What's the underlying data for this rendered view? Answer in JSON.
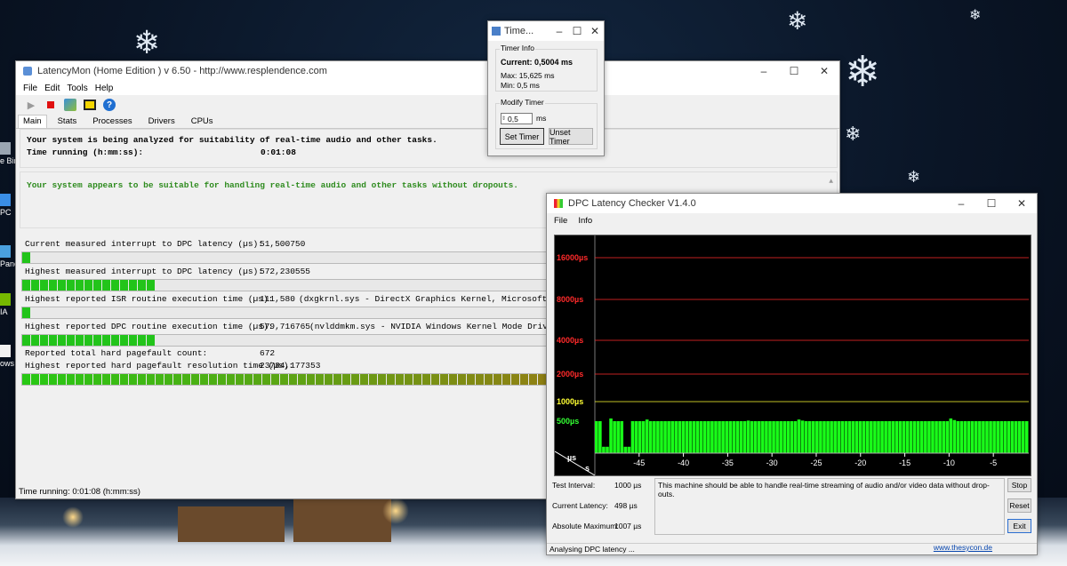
{
  "desktop": {
    "icons": [
      {
        "label": "e Bin",
        "name": "desktop-icon-recycle-bin"
      },
      {
        "label": "PC",
        "name": "desktop-icon-this-pc"
      },
      {
        "label": "Pane",
        "name": "desktop-icon-control-panel"
      },
      {
        "label": "IA",
        "name": "desktop-icon-nvidia"
      },
      {
        "label": "ows",
        "name": "desktop-icon-windows"
      }
    ]
  },
  "latencymon": {
    "title": "LatencyMon  (Home Edition )  v 6.50 - http://www.resplendence.com",
    "menu": [
      "File",
      "Edit",
      "Tools",
      "Help"
    ],
    "tabs": [
      "Main",
      "Stats",
      "Processes",
      "Drivers",
      "CPUs"
    ],
    "active_tab": "Main",
    "analysis_line": "Your system is being analyzed for suitability of real-time audio and other tasks.",
    "time_running_label": "Time running (h:mm:ss):",
    "time_running_value": "0:01:08",
    "verdict": "Your system appears to be suitable for handling real-time audio and other tasks without dropouts.",
    "verdict_color": "#2e8b1e",
    "metrics": {
      "current_interrupt_label": "Current measured interrupt to DPC latency (µs):",
      "current_interrupt_value": "51,500750",
      "current_interrupt_level": 0.011,
      "highest_interrupt_label": "Highest measured interrupt to DPC latency (µs):",
      "highest_interrupt_value": "572,230555",
      "highest_interrupt_level": 0.159,
      "isr_label": "Highest reported ISR routine execution time (µs):",
      "isr_value": "111,580",
      "isr_driver": "(dxgkrnl.sys - DirectX Graphics Kernel, Microsoft Corporation)",
      "isr_level": 0.013,
      "dpc_label": "Highest reported DPC routine execution time (µs):",
      "dpc_value": "579,716765",
      "dpc_driver": "(nvlddmkm.sys - NVIDIA Windows Kernel Mode Driver, Version",
      "dpc_level": 0.165,
      "pagefault_count_label": "Reported total hard pagefault count:",
      "pagefault_count_value": "672",
      "pagefault_res_label": "Highest reported hard pagefault resolution time (µs):",
      "pagefault_res_value": "23784,177353",
      "pagefault_res_level": 1.0
    },
    "status": "Time running: 0:01:08  (h:mm:ss)"
  },
  "timer": {
    "title": "Time...",
    "group_info": "Timer Info",
    "current_label": "Current:",
    "current_value": "0,5004 ms",
    "max_line": "Max: 15,625 ms",
    "min_line": "Min: 0,5 ms",
    "group_modify": "Modify Timer",
    "input_value": "0,5",
    "unit": "ms",
    "set_button": "Set Timer",
    "unset_button": "Unset Timer"
  },
  "dpc": {
    "title": "DPC Latency Checker V1.4.0",
    "menu": [
      "File",
      "Info"
    ],
    "y_labels": [
      {
        "text": "16000µs",
        "value": 16000,
        "color": "#ff2a2a"
      },
      {
        "text": "8000µs",
        "value": 8000,
        "color": "#ff2a2a"
      },
      {
        "text": "4000µs",
        "value": 4000,
        "color": "#ff2a2a"
      },
      {
        "text": "2000µs",
        "value": 2000,
        "color": "#ff2a2a"
      },
      {
        "text": "1000µs",
        "value": 1000,
        "color": "#ffff33"
      },
      {
        "text": "500µs",
        "value": 500,
        "color": "#33ff33"
      }
    ],
    "x_labels": [
      "-45",
      "-40",
      "-35",
      "-30",
      "-25",
      "-20",
      "-15",
      "-10",
      "-5"
    ],
    "axis_units": {
      "y": "µs",
      "x": "s"
    },
    "test_interval_label": "Test Interval:",
    "test_interval_value": "1000 µs",
    "current_latency_label": "Current Latency:",
    "current_latency_value": "498 µs",
    "absolute_max_label": "Absolute Maximum:",
    "absolute_max_value": "1007 µs",
    "message": "This machine should be able to handle real-time streaming of audio and/or video data without drop-outs.",
    "buttons": {
      "stop": "Stop",
      "reset": "Reset",
      "exit": "Exit"
    },
    "status": "Analysing DPC latency ...",
    "link": "www.thesycon.de"
  },
  "chart_data": {
    "type": "bar",
    "title": "",
    "xlabel": "s",
    "ylabel": "µs",
    "x_ticks": [
      -45,
      -40,
      -35,
      -30,
      -25,
      -20,
      -15,
      -10,
      -5
    ],
    "y_ticks": [
      500,
      1000,
      2000,
      4000,
      8000,
      16000
    ],
    "x_range": [
      -50,
      -1
    ],
    "values": [
      500,
      500,
      100,
      100,
      550,
      500,
      500,
      500,
      100,
      100,
      500,
      500,
      500,
      500,
      530,
      500,
      500,
      500,
      500,
      500,
      500,
      500,
      500,
      500,
      500,
      500,
      500,
      500,
      500,
      500,
      500,
      500,
      500,
      500,
      500,
      500,
      500,
      500,
      500,
      500,
      500,
      500,
      510,
      500,
      500,
      500,
      500,
      500,
      500,
      500,
      500,
      500,
      500,
      500,
      500,
      500,
      530,
      510,
      500,
      500,
      500,
      500,
      500,
      500,
      500,
      500,
      500,
      500,
      500,
      500,
      500,
      500,
      500,
      500,
      500,
      500,
      500,
      500,
      500,
      500,
      500,
      500,
      500,
      500,
      500,
      500,
      500,
      500,
      500,
      500,
      500,
      500,
      500,
      500,
      500,
      500,
      500,
      500,
      550,
      520,
      500,
      500,
      500,
      500,
      500,
      500,
      500,
      500,
      500,
      500,
      500,
      500,
      500,
      500,
      500,
      500,
      500,
      500,
      500,
      500
    ],
    "bar_color": "#19ff19"
  }
}
